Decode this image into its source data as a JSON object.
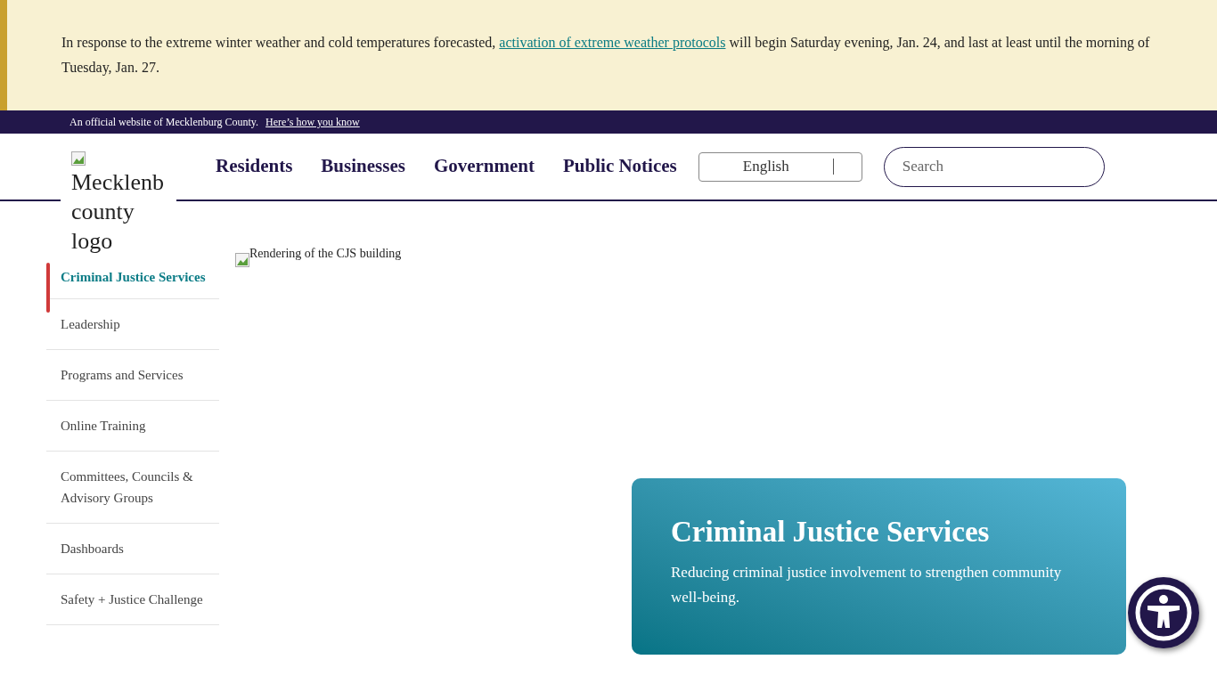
{
  "alert": {
    "text_before": "In response to the extreme winter weather and cold temperatures forecasted, ",
    "link": "activation of extreme weather protocols",
    "text_after": " will begin Saturday evening, Jan. 24, and last at least until the morning of Tuesday, Jan. 27."
  },
  "official_bar": {
    "text": "An official website of Mecklenburg County.",
    "link": "Here’s how you know"
  },
  "header": {
    "logo_alt": "Mecklenb county logo",
    "nav": [
      "Residents",
      "Businesses",
      "Government",
      "Public Notices"
    ],
    "language": {
      "value": "English"
    },
    "search": {
      "placeholder": "Search"
    }
  },
  "sidebar": {
    "items": [
      {
        "label": "Criminal Justice Services",
        "selected": true
      },
      {
        "label": "Leadership",
        "selected": false
      },
      {
        "label": "Programs and Services",
        "selected": false
      },
      {
        "label": "Online Training",
        "selected": false
      },
      {
        "label": "Committees, Councils & Advisory Groups",
        "selected": false
      },
      {
        "label": "Dashboards",
        "selected": false
      },
      {
        "label": "Safety + Justice Challenge",
        "selected": false
      }
    ]
  },
  "hero": {
    "image_alt": "Rendering of the CJS building",
    "title": "Criminal Justice Services",
    "subtitle": "Reducing criminal justice involvement to strengthen community well-being."
  }
}
